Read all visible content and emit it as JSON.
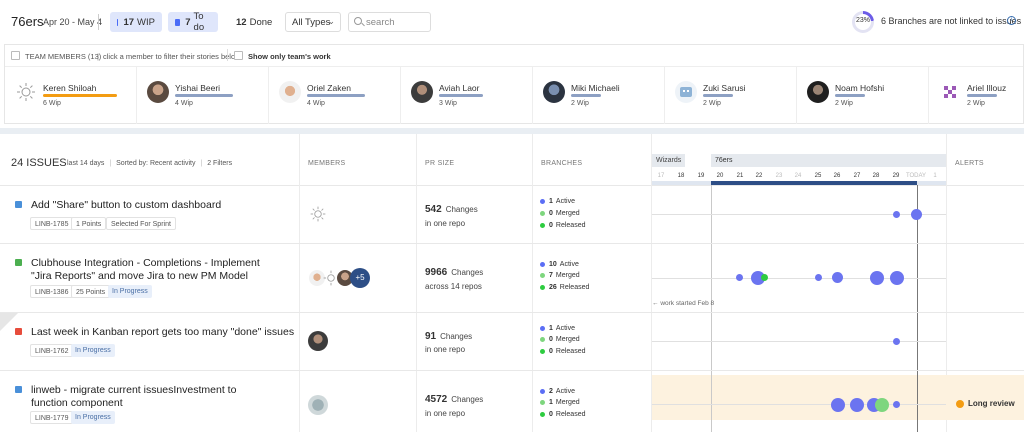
{
  "header": {
    "team": "76ers",
    "dates": "Apr 20 - May 4",
    "filters": [
      {
        "count": "17",
        "label": "WIP",
        "color": "#4a6cf7"
      },
      {
        "count": "7",
        "label": "To do",
        "color": "#4a6cf7"
      },
      {
        "count": "12",
        "label": "Done",
        "color": "#b0b6c3"
      }
    ],
    "types_dropdown": "All Types",
    "search_placeholder": "search",
    "branches_percent": "23%",
    "branches_text": "6 Branches are not linked to issues",
    "info_icon": "i"
  },
  "members_panel": {
    "title": "TEAM MEMBERS (13)",
    "hint": "click a member to filter their stories below",
    "toggle_label": "Show only team's work",
    "members": [
      {
        "name": "Keren Shiloah",
        "wip": "6 Wip",
        "bar_color": "#f39c12"
      },
      {
        "name": "Yishai Beeri",
        "wip": "4 Wip",
        "bar_color": "#8da0c3"
      },
      {
        "name": "Oriel Zaken",
        "wip": "4 Wip",
        "bar_color": "#8da0c3"
      },
      {
        "name": "Aviah Laor",
        "wip": "3 Wip",
        "bar_color": "#8da0c3"
      },
      {
        "name": "Miki Michaeli",
        "wip": "2 Wip",
        "bar_color": "#8da0c3"
      },
      {
        "name": "Zuki Sarusi",
        "wip": "2 Wip",
        "bar_color": "#8da0c3"
      },
      {
        "name": "Noam Hofshi",
        "wip": "2 Wip",
        "bar_color": "#8da0c3"
      },
      {
        "name": "Ariel Illouz",
        "wip": "2 Wip",
        "bar_color": "#8da0c3"
      }
    ]
  },
  "table": {
    "issue_count": "24 ISSUES",
    "meta": [
      "last 14 days",
      "Sorted by: Recent activity",
      "2 Filters"
    ],
    "columns": {
      "members": "MEMBERS",
      "pr_size": "PR SIZE",
      "branches": "BRANCHES",
      "alerts": "ALERTS"
    },
    "timeline": {
      "epics": [
        "Wizards",
        "76ers"
      ],
      "ticks": [
        "17",
        "18",
        "19",
        "20",
        "21",
        "22",
        "23",
        "24",
        "25",
        "26",
        "27",
        "28",
        "29",
        "TODAY",
        "1"
      ]
    },
    "work_started": "work started Feb 8",
    "rows": [
      {
        "title": "Add \"Share\" button to custom dashboard",
        "key": "LINB-1785",
        "points": "1 Points",
        "status": "Selected For Sprint",
        "pr_changes": "542",
        "changes_label": "Changes",
        "pr_scope": "in one repo",
        "active": "1",
        "merged": "0",
        "released": "0",
        "type_color": "#4a90d9"
      },
      {
        "title": "Clubhouse Integration - Completions - Implement \"Jira Reports\" and move Jira to new PM Model",
        "key": "LINB-1386",
        "points": "25 Points",
        "status": "In Progress",
        "pr_changes": "9966",
        "changes_label": "Changes",
        "pr_scope": "across 14 repos",
        "active": "10",
        "merged": "7",
        "released": "26",
        "type_color": "#4caf50",
        "extra_members": "+5"
      },
      {
        "title": "Last week in Kanban report gets too many \"done\" issues",
        "key": "LINB-1762",
        "status": "In Progress",
        "pr_changes": "91",
        "changes_label": "Changes",
        "pr_scope": "in one repo",
        "active": "1",
        "merged": "0",
        "released": "0",
        "type_color": "#e74c3c"
      },
      {
        "title": "linweb - migrate current issuesInvestment to function component",
        "key": "LINB-1779",
        "status": "In Progress",
        "pr_changes": "4572",
        "changes_label": "Changes",
        "pr_scope": "in one repo",
        "active": "2",
        "merged": "1",
        "released": "0",
        "type_color": "#4a90d9",
        "alert": "Long review"
      }
    ],
    "branch_labels": {
      "active": "Active",
      "merged": "Merged",
      "released": "Released"
    },
    "branch_colors": {
      "active": "#5b6ef5",
      "merged": "#7ed67e",
      "released": "#2ecc40"
    }
  }
}
